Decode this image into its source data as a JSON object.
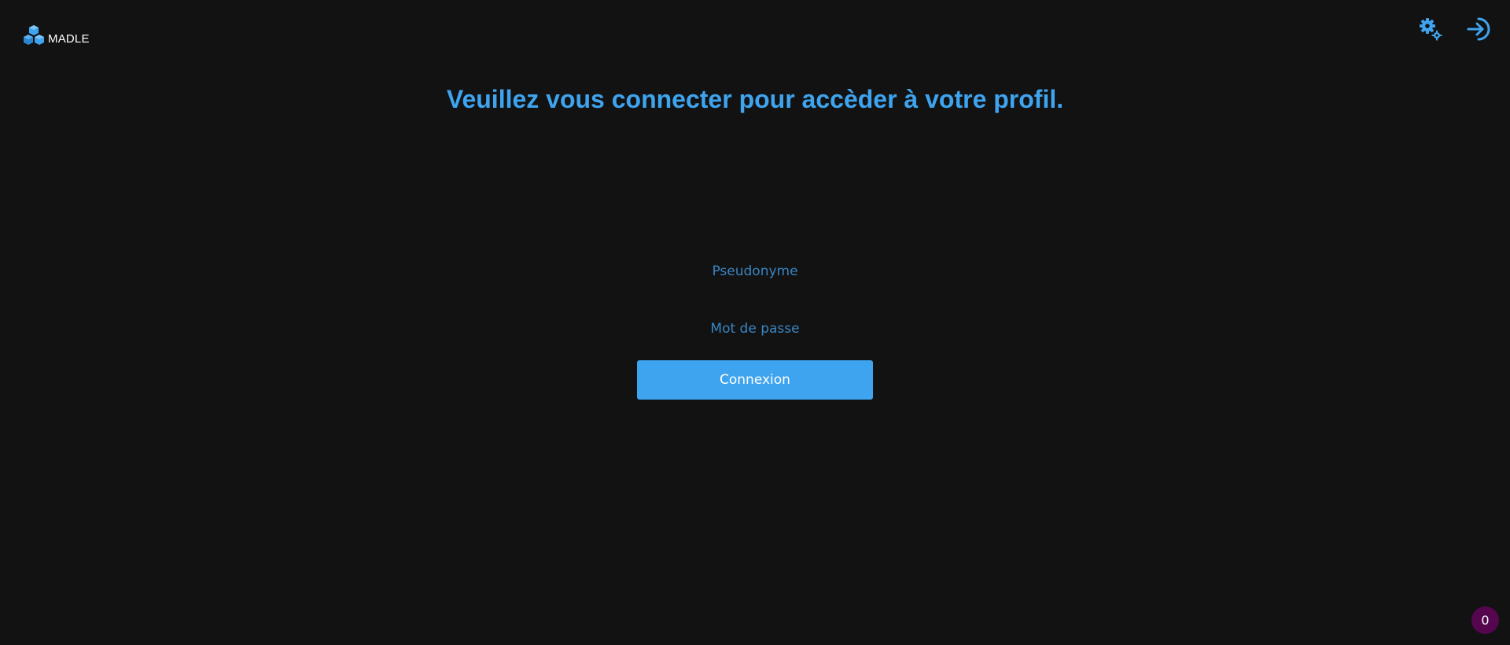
{
  "header": {
    "logo_text": "MADLE",
    "settings_icon": "gears-icon",
    "login_icon": "sign-in-icon"
  },
  "main": {
    "title": "Veuillez vous connecter pour accèder à votre profil."
  },
  "form": {
    "username_placeholder": "Pseudonyme",
    "username_value": "",
    "password_placeholder": "Mot de passe",
    "password_value": "",
    "submit_label": "Connexion"
  },
  "badge": {
    "count": "0"
  },
  "colors": {
    "background": "#121212",
    "accent": "#3fa4ef",
    "placeholder": "#3a85c2",
    "badge": "#55064f"
  }
}
